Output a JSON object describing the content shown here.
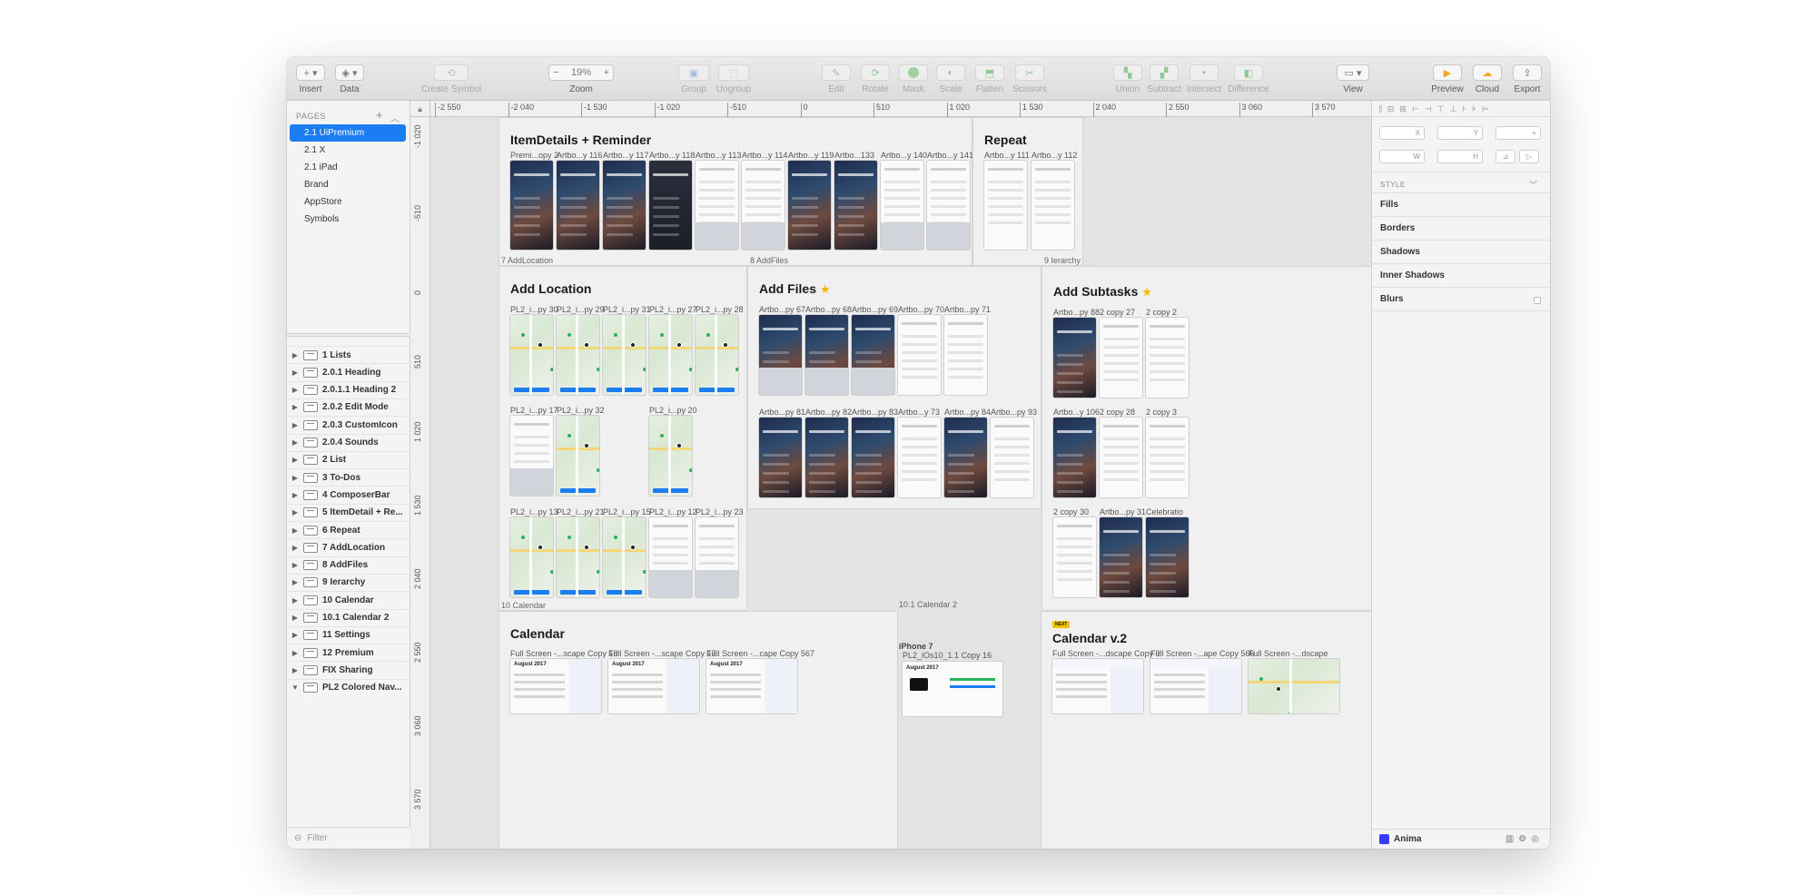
{
  "toolbar": {
    "insert": "Insert",
    "data": "Data",
    "create_symbol": "Create Symbol",
    "zoom_label": "Zoom",
    "zoom_value": "19%",
    "group": "Group",
    "ungroup": "Ungroup",
    "edit": "Edit",
    "rotate": "Rotate",
    "mask": "Mask",
    "scale": "Scale",
    "flatten": "Flatten",
    "scissors": "Scissors",
    "union": "Union",
    "subtract": "Subtract",
    "intersect": "Intersect",
    "difference": "Difference",
    "view": "View",
    "preview": "Preview",
    "cloud": "Cloud",
    "export": "Export"
  },
  "pages": {
    "header": "PAGES",
    "items": [
      "2.1 UiPremium",
      "2.1 X",
      "2.1 iPad",
      "Brand",
      "AppStore",
      "Symbols"
    ]
  },
  "layers": [
    "1 Lists",
    "2.0.1 Heading",
    "2.0.1.1 Heading 2",
    "2.0.2 Edit Mode",
    "2.0.3 CustomIcon",
    "2.0.4 Sounds",
    "2 List",
    "3 To-Dos",
    "4 ComposerBar",
    "5 ItemDetail + Re...",
    "6 Repeat",
    "7 AddLocation",
    "8 AddFiles",
    "9 Ierarchy",
    "10 Calendar",
    "10.1 Calendar 2",
    "11 Settings",
    "12 Premium",
    "FIX Sharing",
    "PL2 Colored Nav..."
  ],
  "filter_placeholder": "Filter",
  "ruler": {
    "top": [
      "-2 550",
      "-2 040",
      "-1 530",
      "-1 020",
      "-510",
      "0",
      "510",
      "1 020",
      "1 530",
      "2 040",
      "2 550",
      "3 060",
      "3 570"
    ],
    "left": [
      "-1 020",
      "-510",
      "0",
      "510",
      "1 020",
      "1 530",
      "2 040",
      "2 550",
      "3 060",
      "3 570"
    ]
  },
  "boards": {
    "itemdetails": {
      "title": "ItemDetails + Reminder",
      "foot_left": "7 AddLocation",
      "foot_mid": "8 AddFiles",
      "artboards": [
        "Premi...opy 2",
        "Artbo...y 116",
        "Artbo...y 117",
        "Artbo...y 118",
        "Artbo...y 113",
        "Artbo...y 114",
        "Artbo...y 119",
        "Artbo...133",
        "Artbo...y 140",
        "Artbo...y 141"
      ]
    },
    "repeat": {
      "title": "Repeat",
      "foot": "9 Ierarchy",
      "artboards": [
        "Artbo...y 111",
        "Artbo...y 112"
      ]
    },
    "addlocation": {
      "title": "Add Location",
      "foot": "10 Calendar",
      "row1": [
        "PL2_i...py 30",
        "PL2_i...py 29",
        "PL2_i...py 31",
        "PL2_i...py 27",
        "PL2_i...py 28"
      ],
      "row2": [
        "PL2_i...py 17",
        "PL2_i...py 32",
        "PL2_i...py 20"
      ],
      "row3": [
        "PL2_i...py 13",
        "PL2_i...py 21",
        "PL2_i...py 15",
        "PL2_i...py 12",
        "PL2_i...py 23"
      ]
    },
    "addfiles": {
      "title": "Add Files",
      "foot": "10.1 Calendar 2",
      "row1": [
        "Artbo...py 67",
        "Artbo...py 68",
        "Artbo...py 69",
        "Artbo...py 70",
        "Artbo...py 71"
      ],
      "row2": [
        "Artbo...py 81",
        "Artbo...py 82",
        "Artbo...py 83",
        "Artbo...y 73",
        "Artbo...py 84",
        "Artbo...py 93"
      ]
    },
    "addsubtasks": {
      "title": "Add Subtasks",
      "row1": [
        "Artbo...py 88",
        "2 copy 27",
        "2 copy 2"
      ],
      "row2": [
        "Artbo...y 106",
        "2 copy 28",
        "2 copy 3"
      ],
      "row3": [
        "2 copy 30",
        "Artbo...py 31",
        "Celebratio"
      ]
    },
    "calendar": {
      "title": "Calendar",
      "artboards": [
        "Full Screen -...scape Copy 18",
        "Full Screen -...scape Copy 17",
        "Full Screen -...cape Copy 567"
      ],
      "month": "August 2017"
    },
    "iphone": {
      "title": "iPhone 7",
      "label": "PL2_iOs10_1.1 Copy 16",
      "month": "August 2017"
    },
    "calendar2": {
      "title": "Calendar v.2",
      "badge": "NEXT",
      "artboards": [
        "Full Screen -...dscape Copy 3",
        "Full Screen -...ape Copy 566",
        "Full Screen -...dscape"
      ]
    }
  },
  "inspector": {
    "x": "X",
    "y": "Y",
    "w": "W",
    "h": "H",
    "style_header": "STYLE",
    "sections": [
      "Fills",
      "Borders",
      "Shadows",
      "Inner Shadows",
      "Blurs"
    ],
    "plugin": "Anima"
  },
  "colors": {
    "accent": "#1c7cf2",
    "star": "#f2b600",
    "preview": "#f5a623"
  }
}
